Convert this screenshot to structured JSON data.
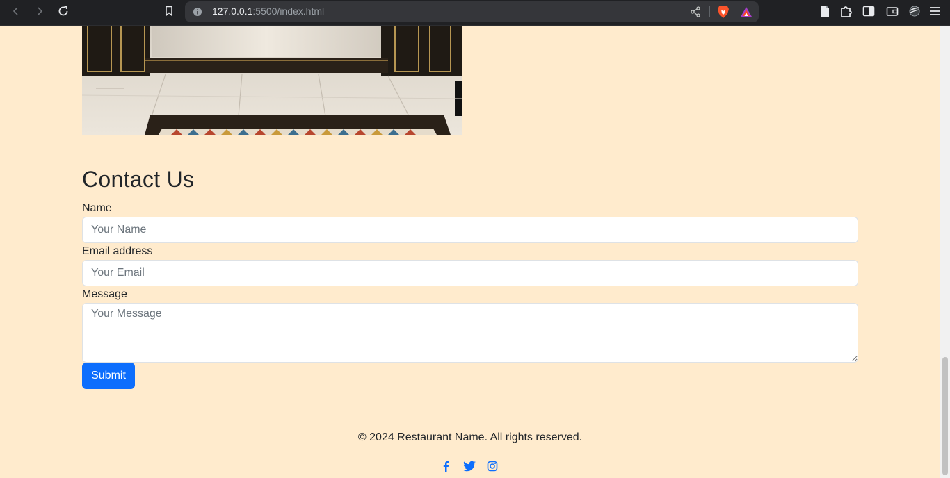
{
  "browser": {
    "url_host": "127.0.0.1",
    "url_path": ":5500/index.html",
    "icons": {
      "back": "back-arrow-icon",
      "forward": "forward-arrow-icon",
      "reload": "reload-icon",
      "bookmark": "bookmark-icon",
      "site_info": "info-icon",
      "share": "share-icon",
      "brave_shield": "brave-shield-icon",
      "rewards": "rewards-triangle-icon",
      "reader": "reader-mode-icon",
      "extensions": "puzzle-extensions-icon",
      "sidebar": "sidebar-toggle-icon",
      "wallet": "wallet-icon",
      "vpn": "vpn-icon",
      "menu": "hamburger-menu-icon"
    }
  },
  "contact": {
    "title": "Contact Us",
    "name_label": "Name",
    "name_placeholder": "Your Name",
    "email_label": "Email address",
    "email_placeholder": "Your Email",
    "message_label": "Message",
    "message_placeholder": "Your Message",
    "submit_label": "Submit"
  },
  "footer": {
    "copyright": "© 2024 Restaurant Name. All rights reserved.",
    "social": [
      "facebook-icon",
      "twitter-icon",
      "instagram-icon"
    ]
  },
  "colors": {
    "page_background": "#ffebcd",
    "primary": "#0d6efd",
    "text": "#212529",
    "chrome_background": "#202124"
  }
}
